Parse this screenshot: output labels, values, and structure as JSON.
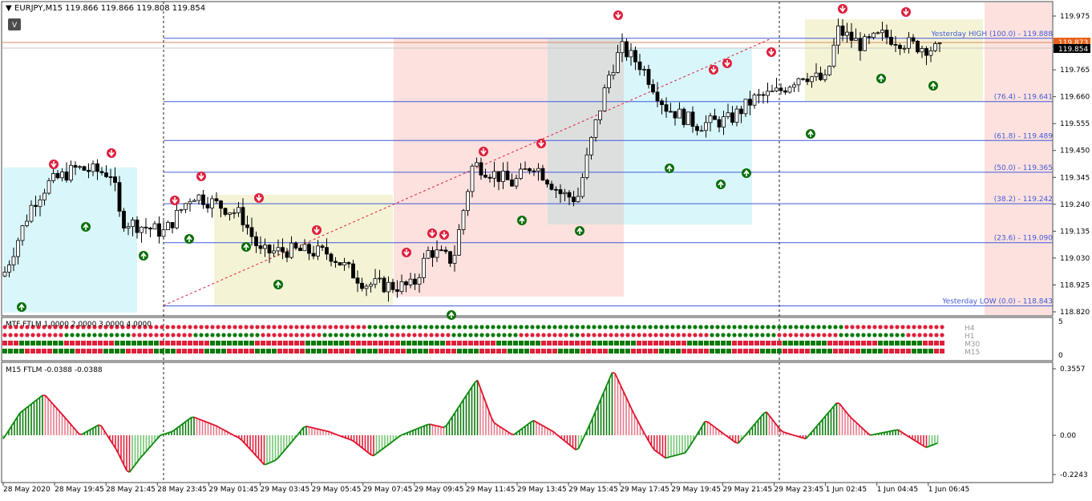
{
  "symbol_header": "EURJPY,M15  119.866 119.866 119.808 119.854",
  "v_button": "V",
  "colors": {
    "bull_arrow": "#0a6e0a",
    "bear_arrow": "#dd1f3c",
    "fib_line": "#3f5bd8",
    "histo_up": "#0a7a0a",
    "histo_down": "#e0203a",
    "signal_line_up": "#0a8a0a",
    "signal_line_down": "#e0102a",
    "zone_cyan": "#d9f7fb",
    "zone_yellow": "#f5f3d6",
    "zone_pink": "#fde1de",
    "zone_gray": "#dcdfdd"
  },
  "price_axis": {
    "labels": [
      "119.975",
      "119.855",
      "119.765",
      "119.660",
      "119.555",
      "119.450",
      "119.345",
      "119.240",
      "119.135",
      "119.030",
      "118.925",
      "118.820"
    ],
    "current_price": "119.854",
    "yesterday_high_tag": "119.873"
  },
  "fib_levels": [
    {
      "name": "Yesterday HIGH",
      "pct": "(100.0)",
      "value": "119.888"
    },
    {
      "name": "",
      "pct": "(76.4)",
      "value": "119.641"
    },
    {
      "name": "",
      "pct": "(61.8)",
      "value": "119.489"
    },
    {
      "name": "",
      "pct": "(50.0)",
      "value": "119.365"
    },
    {
      "name": "",
      "pct": "(38.2)",
      "value": "119.242"
    },
    {
      "name": "",
      "pct": "(23.6)",
      "value": "119.090"
    },
    {
      "name": "Yesterday LOW",
      "pct": "(0.0)",
      "value": "118.843"
    }
  ],
  "mtf_panel": {
    "title": "MTF FTLM 1.0000 2.0000 3.0000 4.0000",
    "rows": [
      "H4",
      "H1",
      "M30",
      "M15"
    ],
    "axis": [
      "5",
      "0"
    ]
  },
  "ftlm_panel": {
    "title": "M15 FTLM -0.0388 -0.0388",
    "axis": [
      "0.3557",
      "0.00",
      "-0.2243"
    ]
  },
  "time_axis": [
    "28 May 2020",
    "28 May 19:45",
    "28 May 21:45",
    "28 May 23:45",
    "29 May 01:45",
    "29 May 03:45",
    "29 May 05:45",
    "29 May 07:45",
    "29 May 09:45",
    "29 May 11:45",
    "29 May 13:45",
    "29 May 15:45",
    "29 May 17:45",
    "29 May 19:45",
    "29 May 21:45",
    "29 May 23:45",
    "1 Jun 02:45",
    "1 Jun 04:45",
    "1 Jun 06:45"
  ]
}
